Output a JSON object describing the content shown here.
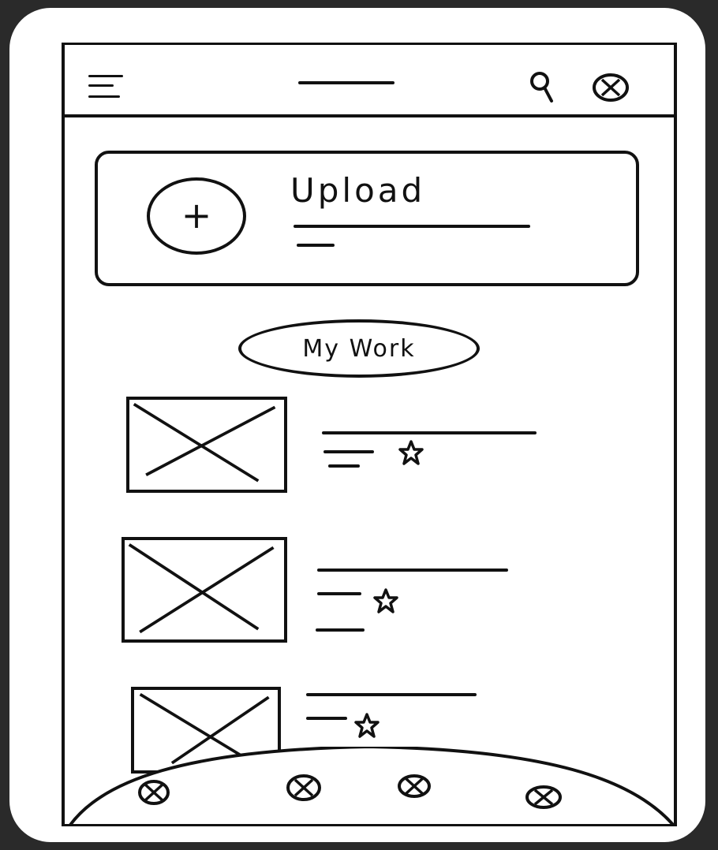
{
  "upload": {
    "title": "Upload",
    "button_symbol": "+"
  },
  "my_work": {
    "label": "My Work"
  },
  "icons": {
    "menu": "menu-icon",
    "search": "search-icon",
    "profile": "placeholder-icon",
    "image": "image-placeholder-icon",
    "star": "star-icon"
  },
  "colors": {
    "ink": "#111111",
    "paper": "#ffffff",
    "frame": "#2a2a2a"
  }
}
